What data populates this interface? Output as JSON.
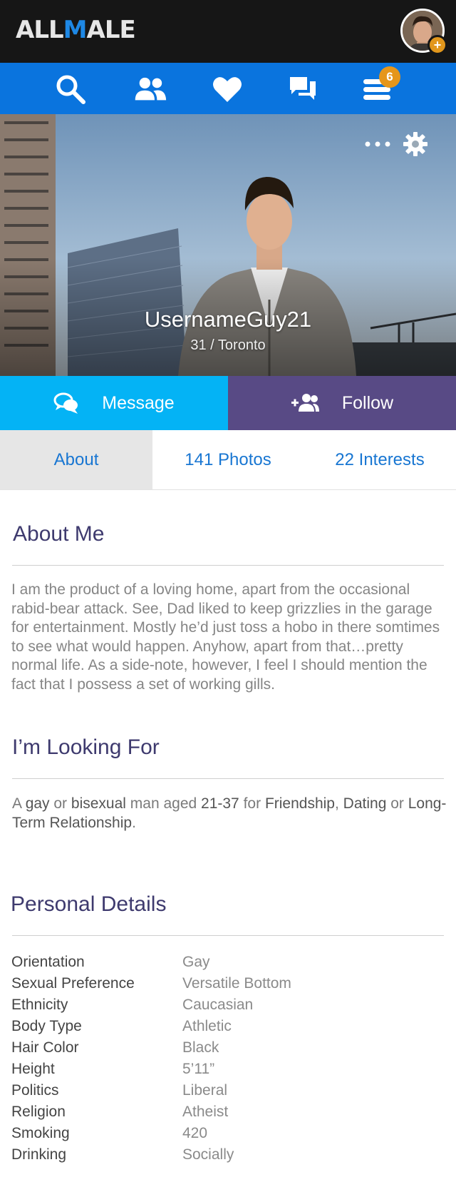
{
  "header": {
    "logo_part1": "ALL",
    "logo_part2": "M",
    "logo_part3": "ALE",
    "avatar_badge": "+"
  },
  "nav": {
    "items": [
      {
        "icon": "search-icon"
      },
      {
        "icon": "people-icon"
      },
      {
        "icon": "heart-icon"
      },
      {
        "icon": "chat-icon"
      },
      {
        "icon": "menu-icon"
      }
    ],
    "badge_count": "6"
  },
  "profile": {
    "username": "UsernameGuy21",
    "age_location": "31 / Toronto"
  },
  "actions": {
    "message_label": "Message",
    "follow_label": "Follow"
  },
  "tabs": [
    {
      "label": "About",
      "active": true
    },
    {
      "label": "141 Photos",
      "active": false
    },
    {
      "label": "22 Interests",
      "active": false
    }
  ],
  "about": {
    "title": "About Me",
    "text": "I am the product of a loving home, apart from the occasional rabid-bear attack. See, Dad liked to keep grizzlies in the garage for entertainment. Mostly he’d just toss a hobo in there somtimes to see what would happen. Anyhow, apart from that…pretty normal life. As a side-note, however, I feel I should mention the fact that I possess a set of working gills."
  },
  "looking_for": {
    "title": "I’m Looking For",
    "t1": "A ",
    "orientation1": "gay",
    "t2": " or ",
    "orientation2": "bisexual",
    "t3": " man aged ",
    "age_range": "21-37",
    "t4": " for ",
    "goal1": "Friendship",
    "t5": ", ",
    "goal2": "Dating",
    "t6": " or ",
    "goal3": "Long-Term Relationship",
    "t7": "."
  },
  "details": {
    "title": "Personal Details",
    "rows": [
      {
        "label": "Orientation",
        "value": "Gay"
      },
      {
        "label": "Sexual Preference",
        "value": "Versatile Bottom"
      },
      {
        "label": "Ethnicity",
        "value": "Caucasian"
      },
      {
        "label": "Body Type",
        "value": "Athletic"
      },
      {
        "label": "Hair Color",
        "value": "Black"
      },
      {
        "label": "Height",
        "value": "5’11”"
      },
      {
        "label": "Politics",
        "value": "Liberal"
      },
      {
        "label": "Religion",
        "value": "Atheist"
      },
      {
        "label": "Smoking",
        "value": "420"
      },
      {
        "label": "Drinking",
        "value": "Socially"
      }
    ]
  },
  "colors": {
    "nav_blue": "#0a74de",
    "message_blue": "#04b3f5",
    "follow_purple": "#584a85",
    "badge_orange": "#e5961b",
    "heading_purple": "#3e3a6e"
  }
}
